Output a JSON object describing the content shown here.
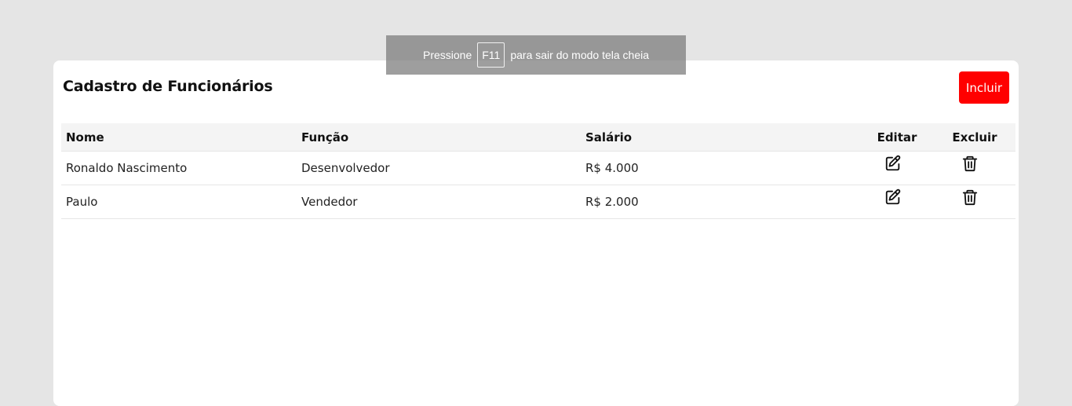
{
  "page": {
    "title": "Cadastro de Funcionários",
    "add_button_label": "Incluir"
  },
  "table": {
    "headers": {
      "name": "Nome",
      "role": "Função",
      "salary": "Salário",
      "edit": "Editar",
      "delete": "Excluir"
    },
    "rows": [
      {
        "name": "Ronaldo Nascimento",
        "role": "Desenvolvedor",
        "salary": "R$ 4.000"
      },
      {
        "name": "Paulo",
        "role": "Vendedor",
        "salary": "R$ 2.000"
      }
    ]
  },
  "fullscreen_notice": {
    "prefix": "Pressione",
    "key": "F11",
    "suffix": "para sair do modo tela cheia"
  },
  "colors": {
    "background": "#e5e5e5",
    "card": "#ffffff",
    "accent": "#ff0000",
    "header_row": "#f4f4f4"
  },
  "icons": {
    "edit": "edit-icon",
    "delete": "trash-icon"
  }
}
